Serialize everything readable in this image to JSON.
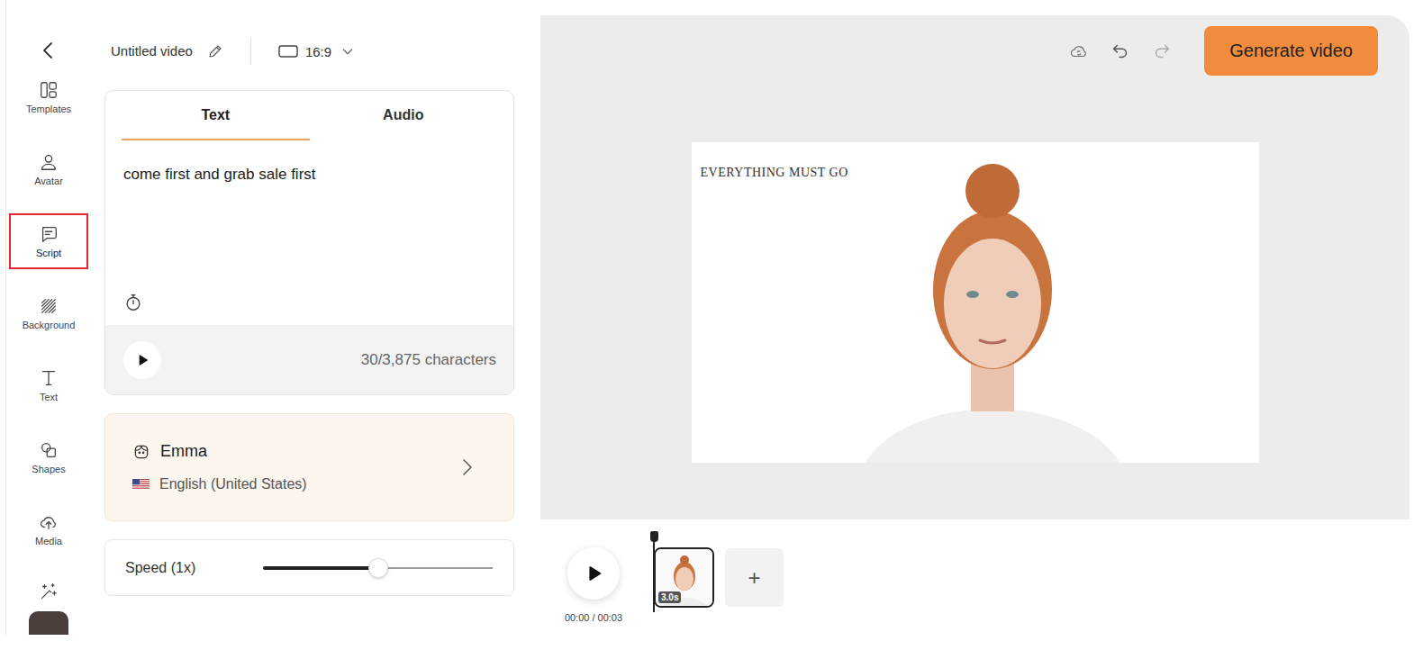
{
  "topbar": {
    "title": "Untitled video",
    "aspect_ratio": "16:9"
  },
  "sidebar": {
    "items": [
      {
        "label": "Templates",
        "selected": false
      },
      {
        "label": "Avatar",
        "selected": false
      },
      {
        "label": "Script",
        "selected": true
      },
      {
        "label": "Background",
        "selected": false
      },
      {
        "label": "Text",
        "selected": false
      },
      {
        "label": "Shapes",
        "selected": false
      },
      {
        "label": "Media",
        "selected": false
      }
    ]
  },
  "script": {
    "tabs": [
      {
        "label": "Text",
        "selected": true
      },
      {
        "label": "Audio",
        "selected": false
      }
    ],
    "text": "come first and grab sale first",
    "character_count": "30/3,875 characters"
  },
  "voice": {
    "name": "Emma",
    "language": "English (United States)"
  },
  "speed": {
    "label": "Speed (1x)",
    "level": 0.5
  },
  "toolbar": {
    "undo_enabled": true,
    "redo_enabled": false,
    "button": "Generate video"
  },
  "canvas": {
    "headline": "EVERYTHING MUST GO"
  },
  "timeline": {
    "time": "00:00 / 00:03",
    "clips": [
      {
        "duration": "3.0s",
        "selected": true
      }
    ],
    "add_label": "+"
  }
}
